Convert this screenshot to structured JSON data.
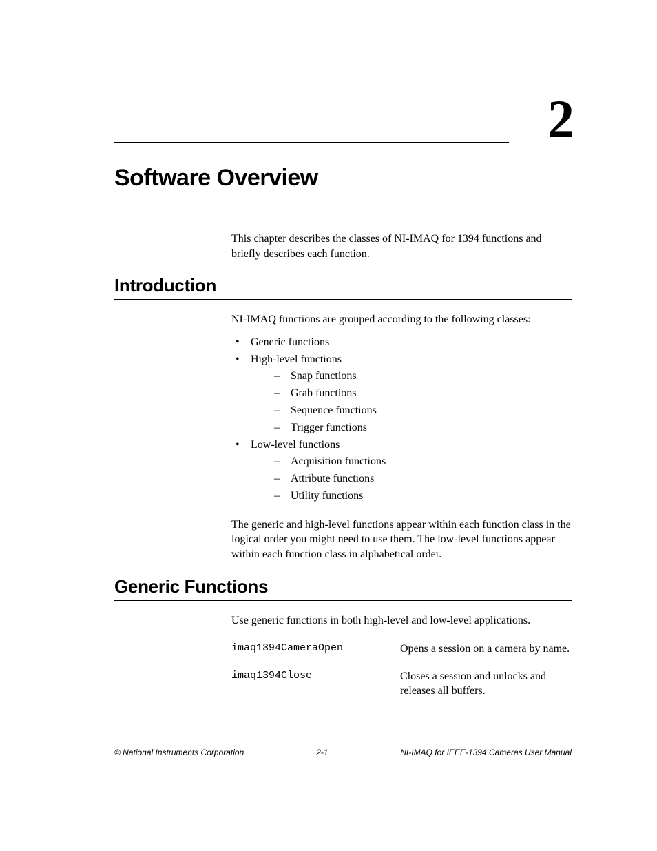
{
  "chapter": {
    "number": "2",
    "title": "Software Overview",
    "intro": "This chapter describes the classes of NI-IMAQ for 1394 functions and briefly describes each function."
  },
  "sections": {
    "introduction": {
      "heading": "Introduction",
      "lead": "NI-IMAQ functions are grouped according to the following classes:",
      "bullets": {
        "b0": "Generic functions",
        "b1": "High-level functions",
        "b1_sub": {
          "s0": "Snap functions",
          "s1": "Grab functions",
          "s2": "Sequence functions",
          "s3": "Trigger functions"
        },
        "b2": "Low-level functions",
        "b2_sub": {
          "s0": "Acquisition functions",
          "s1": "Attribute functions",
          "s2": "Utility functions"
        }
      },
      "tail": "The generic and high-level functions appear within each function class in the logical order you might need to use them. The low-level functions appear within each function class in alphabetical order."
    },
    "generic": {
      "heading": "Generic Functions",
      "lead": "Use generic functions in both high-level and low-level applications.",
      "functions": {
        "f0": {
          "name": "imaq1394CameraOpen",
          "desc": "Opens a session on a camera by name."
        },
        "f1": {
          "name": "imaq1394Close",
          "desc": "Closes a session and unlocks and releases all buffers."
        }
      }
    }
  },
  "footer": {
    "left": "© National Instruments Corporation",
    "center": "2-1",
    "right": "NI-IMAQ for IEEE-1394 Cameras User Manual"
  }
}
